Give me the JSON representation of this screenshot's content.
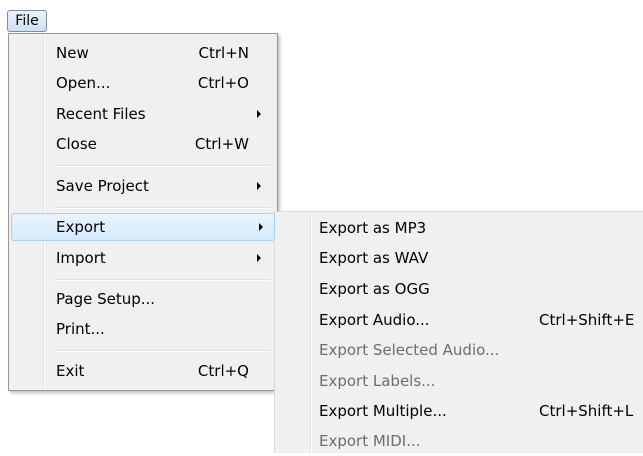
{
  "menubar": {
    "file_label": "File"
  },
  "file_menu": {
    "items": [
      {
        "label": "New",
        "shortcut": "Ctrl+N"
      },
      {
        "label": "Open...",
        "shortcut": "Ctrl+O"
      },
      {
        "label": "Recent Files",
        "submenu": true
      },
      {
        "label": "Close",
        "shortcut": "Ctrl+W"
      },
      {
        "label": "Save Project",
        "submenu": true
      },
      {
        "label": "Export",
        "submenu": true,
        "highlighted": true
      },
      {
        "label": "Import",
        "submenu": true
      },
      {
        "label": "Page Setup..."
      },
      {
        "label": "Print..."
      },
      {
        "label": "Exit",
        "shortcut": "Ctrl+Q"
      }
    ]
  },
  "export_submenu": {
    "items": [
      {
        "label": "Export as MP3",
        "enabled": true
      },
      {
        "label": "Export as WAV",
        "enabled": true
      },
      {
        "label": "Export as OGG",
        "enabled": true
      },
      {
        "label": "Export Audio...",
        "shortcut": "Ctrl+Shift+E",
        "enabled": true
      },
      {
        "label": "Export Selected Audio...",
        "enabled": false
      },
      {
        "label": "Export Labels...",
        "enabled": false
      },
      {
        "label": "Export Multiple...",
        "shortcut": "Ctrl+Shift+L",
        "enabled": true
      },
      {
        "label": "Export MIDI...",
        "enabled": false
      }
    ]
  },
  "colors": {
    "menu_background": "#f0f0f0",
    "highlight_border": "#a8d2fa",
    "highlight_fill": "#d6e9fb",
    "disabled_text": "#6d6d6d"
  }
}
